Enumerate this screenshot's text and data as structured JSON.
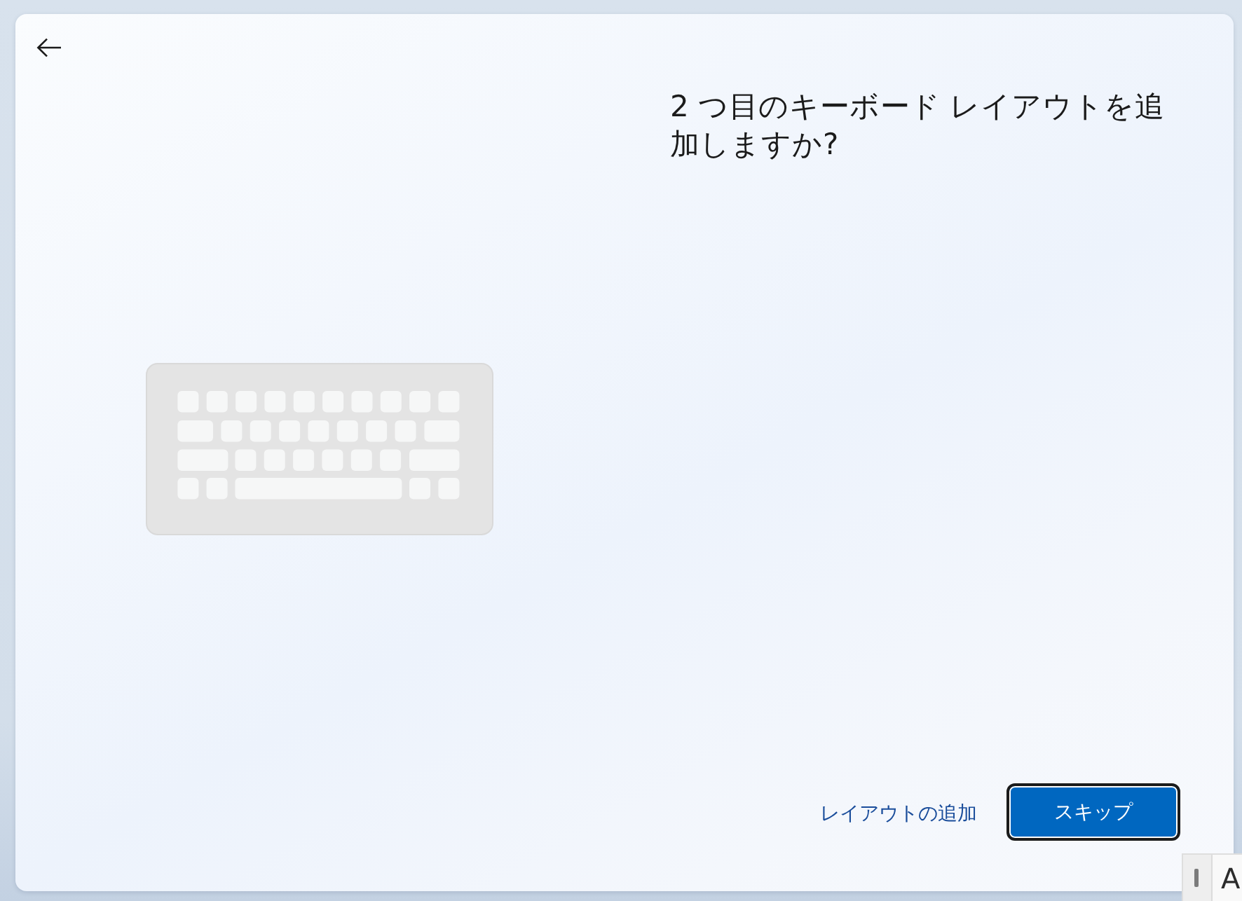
{
  "title": "2 つ目のキーボード レイアウトを追加しますか?",
  "actions": [
    {
      "kind": "link",
      "label": "レイアウトの追加"
    },
    {
      "kind": "button",
      "label": "スキップ",
      "focused": true
    }
  ],
  "ime_indicator": {
    "mode": "A"
  }
}
